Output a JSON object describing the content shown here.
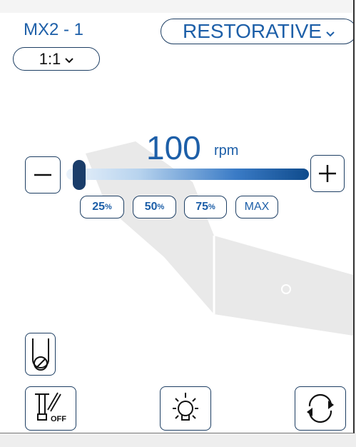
{
  "header": {
    "device_name": "MX2 - 1",
    "mode_label": "RESTORATIVE",
    "ratio_label": "1:1"
  },
  "speed": {
    "value": "100",
    "unit": "rpm",
    "slider_level": 0.03
  },
  "presets": [
    {
      "num": "25",
      "suffix": "%"
    },
    {
      "num": "50",
      "suffix": "%"
    },
    {
      "num": "75",
      "suffix": "%"
    },
    {
      "num": "MAX",
      "suffix": ""
    }
  ],
  "buttons": {
    "off_badge": "OFF"
  },
  "colors": {
    "accent": "#1d5fa8",
    "border": "#1d3e63",
    "thumb": "#1a3d6a"
  }
}
